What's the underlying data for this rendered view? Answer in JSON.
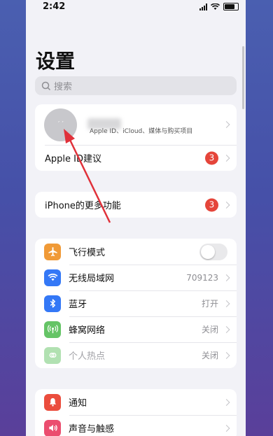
{
  "status": {
    "time": "2:42"
  },
  "page": {
    "title": "设置",
    "search_placeholder": "搜索"
  },
  "profile": {
    "avatar_initial": "′ ′",
    "subtitle": "Apple ID、iCloud、媒体与购买项目"
  },
  "apple_id_row": {
    "label": "Apple ID建议",
    "badge": "3"
  },
  "more_row": {
    "label": "iPhone的更多功能",
    "badge": "3"
  },
  "network": [
    {
      "label": "飞行模式",
      "value": "",
      "icon": "airplane-icon",
      "color": "#f09a37"
    },
    {
      "label": "无线局域网",
      "value": "709123",
      "icon": "wifi-icon",
      "color": "#3478f6"
    },
    {
      "label": "蓝牙",
      "value": "打开",
      "icon": "bluetooth-icon",
      "color": "#3478f6"
    },
    {
      "label": "蜂窝网络",
      "value": "关闭",
      "icon": "cellular-icon",
      "color": "#65c466"
    },
    {
      "label": "个人热点",
      "value": "关闭",
      "icon": "hotspot-icon",
      "color": "#65c466"
    }
  ],
  "notify": [
    {
      "label": "通知",
      "icon": "bell-icon",
      "color": "#eb4d3d"
    },
    {
      "label": "声音与触感",
      "icon": "speaker-icon",
      "color": "#eb4d6f"
    }
  ],
  "annotation": {
    "arrow_color": "#e0313a"
  }
}
